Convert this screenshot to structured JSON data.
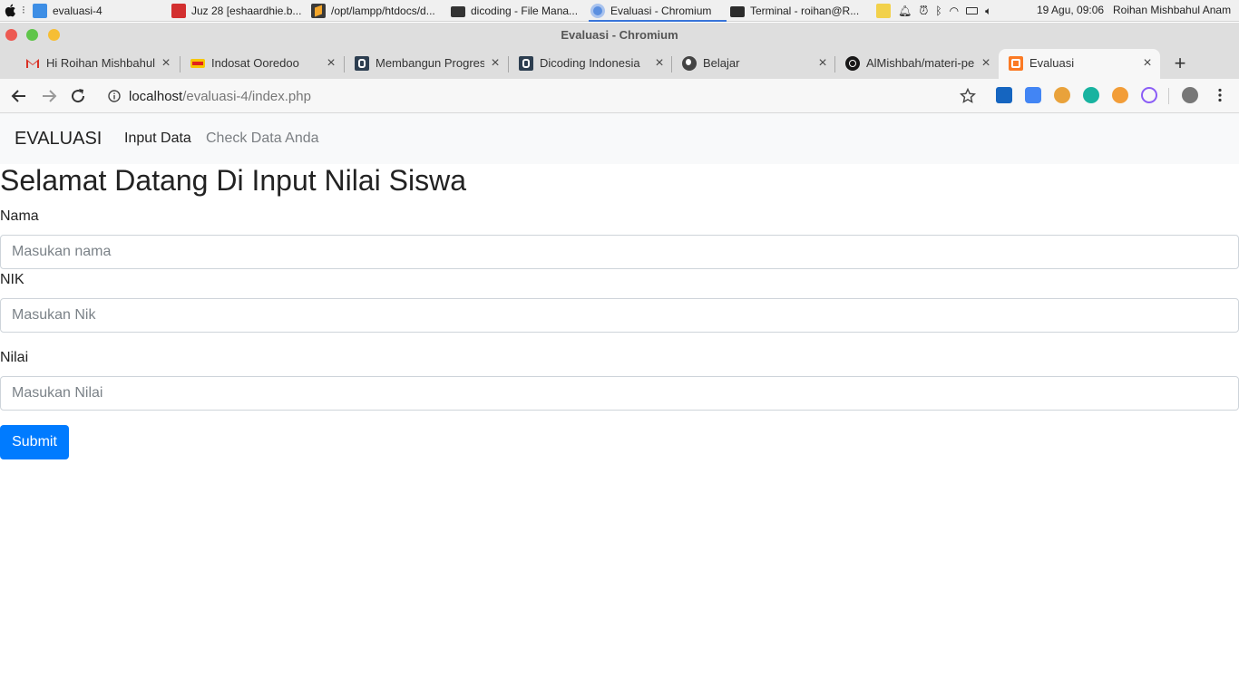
{
  "os_panel": {
    "workspace_label": "evaluasi-4",
    "taskbar": [
      {
        "label": "Juz 28 [eshaardhie.b..."
      },
      {
        "label": "/opt/lampp/htdocs/d..."
      },
      {
        "label": "dicoding - File Mana..."
      },
      {
        "label": "Evaluasi - Chromium"
      },
      {
        "label": "Terminal - roihan@R..."
      }
    ],
    "clock": "19 Agu, 09:06",
    "user": "Roihan Mishbahul Anam"
  },
  "window": {
    "title": "Evaluasi - Chromium"
  },
  "tabs": [
    {
      "title": "Hi Roihan Mishbahul",
      "favicon": "gmail-icon"
    },
    {
      "title": "Indosat Ooredoo",
      "favicon": "indosat-icon"
    },
    {
      "title": "Membangun Progressive",
      "favicon": "dicoding-icon"
    },
    {
      "title": "Dicoding Indonesia",
      "favicon": "dicoding-icon"
    },
    {
      "title": "Belajar",
      "favicon": "globe-icon"
    },
    {
      "title": "AlMishbah/materi-pe",
      "favicon": "github-icon"
    },
    {
      "title": "Evaluasi",
      "favicon": "xampp-icon"
    }
  ],
  "toolbar": {
    "url_host": "localhost",
    "url_path": "/evaluasi-4/index.php"
  },
  "page": {
    "brand": "EVALUASI",
    "nav": [
      {
        "label": "Input Data"
      },
      {
        "label": "Check Data Anda"
      }
    ],
    "heading": "Selamat Datang Di Input Nilai Siswa",
    "form": {
      "nama_label": "Nama",
      "nama_placeholder": "Masukan nama",
      "nik_label": "NIK",
      "nik_placeholder": "Masukan Nik",
      "nilai_label": "Nilai",
      "nilai_placeholder": "Masukan Nilai",
      "submit_label": "Submit"
    }
  },
  "colors": {
    "primary": "#007bff",
    "navbar_bg": "#f8f9fa",
    "active_tab_indicator": "#3874d8"
  }
}
